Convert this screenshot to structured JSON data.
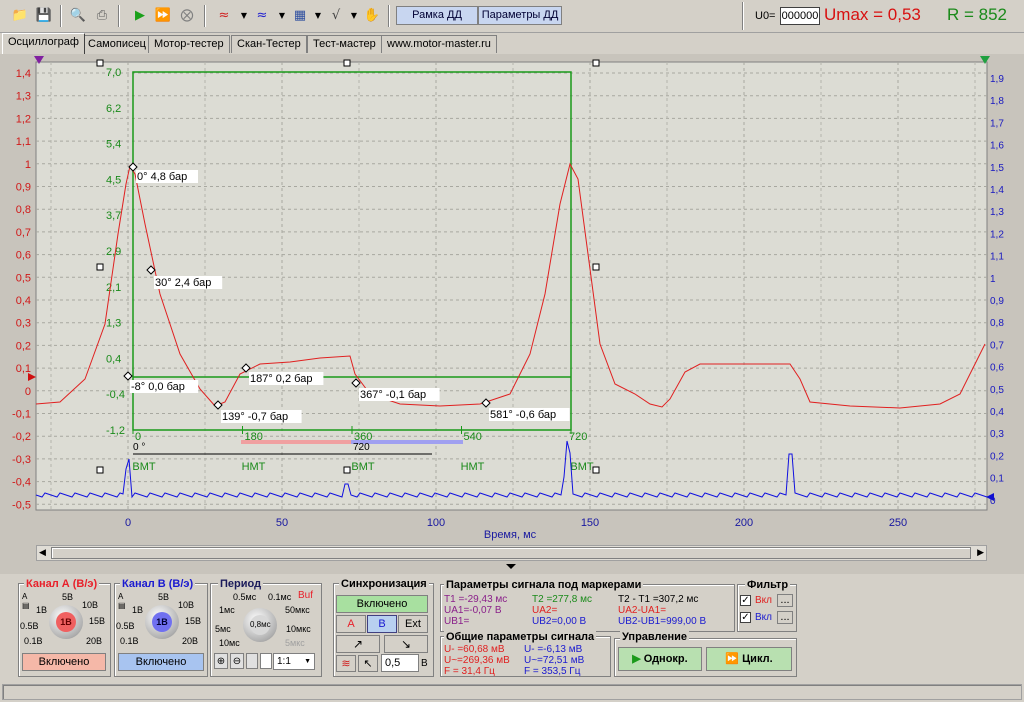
{
  "toolbar": {
    "btn_frame": "Рамка ДД",
    "btn_params": "Параметры ДД",
    "u0_label": "U0=",
    "u0_value": "000000",
    "umax": "Umax = 0,53",
    "r": "R = 852"
  },
  "tabs": [
    "Осциллограф",
    "Самописец",
    "Мотор-тестер",
    "Скан-Тестер",
    "Тест-мастер",
    "www.motor-master.ru"
  ],
  "scope": {
    "left_axis": [
      "1,4",
      "1,3",
      "1,2",
      "1,1",
      "1",
      "0,9",
      "0,8",
      "0,7",
      "0,6",
      "0,5",
      "0,4",
      "0,3",
      "0,2",
      "0,1",
      "0",
      "-0,1",
      "-0,2",
      "-0,3",
      "-0,4",
      "-0,5"
    ],
    "right_axis": [
      "1,9",
      "1,8",
      "1,7",
      "1,6",
      "1,5",
      "1,4",
      "1,3",
      "1,2",
      "1,1",
      "1",
      "0,9",
      "0,8",
      "0,7",
      "0,6",
      "0,5",
      "0,4",
      "0,3",
      "0,2",
      "0,1",
      "0"
    ],
    "x_ticks": [
      "0",
      "50",
      "100",
      "150",
      "200",
      "250"
    ],
    "x_label": "Время, мс",
    "dd_y_ticks": [
      "7,0",
      "6,2",
      "5,4",
      "4,5",
      "3,7",
      "2,9",
      "2,1",
      "1,3",
      "0,4",
      "-0,4",
      "-1,2"
    ],
    "dd_x_ticks": [
      "0",
      "180",
      "360",
      "540",
      "720"
    ],
    "tdc_label": "0 °",
    "cyl_label": "720",
    "phase": [
      "ВМТ",
      "НМТ",
      "ВМТ",
      "НМТ",
      "ВМТ"
    ],
    "points": [
      "0° 4,8 бар",
      "30° 2,4 бар",
      "-8° 0,0 бар",
      "139° -0,7 бар",
      "187° 0,2 бар",
      "367° -0,1 бар",
      "581° -0,6 бар"
    ]
  },
  "chA": {
    "title": "Канал А (В/э)",
    "center": "1В",
    "l1": "1В",
    "l2": "0.5В",
    "l3": "0.1В",
    "r0": "5В",
    "r1": "10В",
    "r2": "15В",
    "r3": "20В",
    "btn": "Включено",
    "color": "#e8202a"
  },
  "chB": {
    "title": "Канал B (В/э)",
    "center": "1В",
    "l1": "1В",
    "l2": "0.5В",
    "l3": "0.1В",
    "r0": "5В",
    "r1": "10В",
    "r2": "15В",
    "r3": "20В",
    "btn": "Включено",
    "color": "#1a1ad0"
  },
  "period": {
    "title": "Период",
    "buf": "Buf",
    "center": "0,8мс",
    "t1": "0.5мс",
    "t2": "0.1мс",
    "t3": "1мс",
    "t4": "50мкс",
    "t5": "5мс",
    "t6": "10мкс",
    "t7": "10мс",
    "t8": "5мкс",
    "ratio": "1:1"
  },
  "sync": {
    "title": "Синхронизация",
    "btn": "Включено",
    "a": "A",
    "b": "B",
    "ext": "Ext",
    "level": "0,5",
    "unit": "В"
  },
  "markers": {
    "title": "Параметры сигнала под маркерами",
    "t1": "T1 =-29,43 мс",
    "t2": "T2 =277,8 мс",
    "dt": "T2 - T1 =307,2 мс",
    "ua1": "UА1=-0,07 В",
    "ua2": "UА2=",
    "dua": "UА2-UА1=",
    "ub1": "UВ1=",
    "ub2": "UВ2=0,00 В",
    "dub": "UВ2-UВ1=999,00 В"
  },
  "general": {
    "title": "Общие параметры сигнала",
    "a1": "U- =60,68 мВ",
    "a2": "U~=269,36 мВ",
    "a3": "F = 31,4 Гц",
    "b1": "U- =-6,13 мВ",
    "b2": "U~=72,51 мВ",
    "b3": "F = 353,5 Гц"
  },
  "filter": {
    "title": "Фильтр",
    "on1": "Вкл",
    "on2": "Вкл",
    "more": "..."
  },
  "control": {
    "title": "Управление",
    "single": "Однокр.",
    "cycle": "Цикл."
  }
}
